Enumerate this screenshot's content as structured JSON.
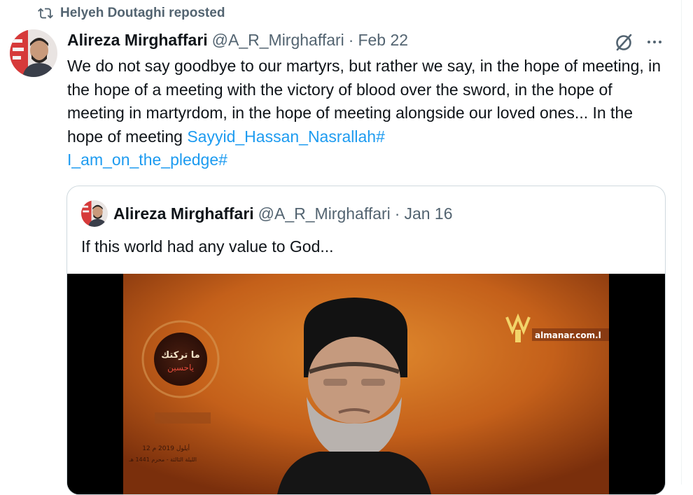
{
  "repost": {
    "icon": "repost-icon",
    "text": "Helyeh Doutaghi reposted"
  },
  "tweet": {
    "author_name": "Alireza Mirghaffari",
    "handle": "@A_R_Mirghaffari",
    "separator": "·",
    "date": "Feb 22",
    "text_main": "We do not say goodbye to our martyrs, but rather we say, in the hope of meeting, in the hope of a meeting with the victory of blood over the sword, in the hope of meeting in martyrdom, in the hope of meeting alongside our loved ones... In the hope of meeting ",
    "hashtag_1": "Sayyid_Hassan_Nasrallah#",
    "hashtag_2": "I_am_on_the_pledge#",
    "icons": [
      "grok-icon",
      "more-icon"
    ]
  },
  "quote": {
    "author_name": "Alireza Mirghaffari",
    "handle": "@A_R_Mirghaffari",
    "separator": "·",
    "date": "Jan 16",
    "text": "If this world had any value to God...",
    "video": {
      "watermark": "almanar.com.l",
      "emblem_line_1": "ما تركتك",
      "emblem_line_2": "ياحسين",
      "date_line": "12 أيلول 2019 م",
      "date_line_2": "الليلة الثالثة - محرم 1441 هـ"
    }
  },
  "colors": {
    "text": "#0f1419",
    "muted": "#536471",
    "link": "#1d9bf0",
    "border": "#cfd9de"
  }
}
